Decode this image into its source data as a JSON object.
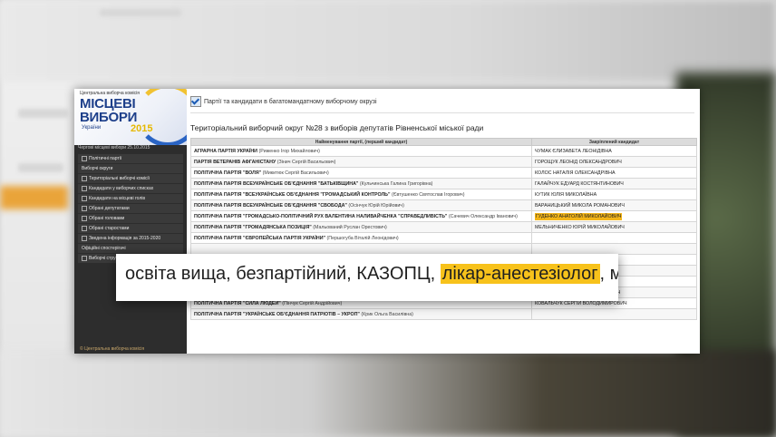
{
  "sidebar": {
    "cvk": "Центральна виборча комісія",
    "logo_title_line1": "МІСЦЕВІ",
    "logo_title_line2": "ВИБОРИ",
    "logo_country": "України",
    "logo_year": "2015",
    "election_date": "Чергові місцеві вибори 25.10.2015",
    "nav": [
      "Політичні партії",
      "Виборчі округи",
      "Територіальні виборчі комісії",
      "Кандидати у виборчих списках",
      "Кандидати на місцеві голів",
      "Обрані депутатами",
      "Обрані головами",
      "Обрані старостами",
      "Зведена інформація за 2015-2020",
      "Офіційні спостерігачі",
      "Виборчі структури"
    ],
    "footer": "© Центральна виборча комісія"
  },
  "content": {
    "checkbox_label": "Партії та кандидати в багатомандатному виборчому окрузі",
    "heading": "Територіальний виборчий округ №28 з виборів депутатів Рівненської міської ради",
    "table_headers": [
      "Найменування партії, (перший кандидат)",
      "Закріплений кандидат"
    ],
    "rows": [
      {
        "party": "АГРАРНА ПАРТІЯ УКРАЇНИ",
        "lead": "(Риженко Ігор Михайлович)",
        "candidate": "ЧУМАК ЄЛИЗАВЕТА ЛЕОНІДІВНА"
      },
      {
        "party": "ПАРТІЯ ВЕТЕРАНІВ АФГАНІСТАНУ",
        "lead": "(Зінич Сергій Васильович)",
        "candidate": "ГОРОЩУК ЛЕОНІД ОЛЕКСАНДРОВИЧ"
      },
      {
        "party": "ПОЛІТИЧНА ПАРТІЯ \"ВОЛЯ\"",
        "lead": "(Микитюк Сергій Васильович)",
        "candidate": "КОЛОС НАТАЛІЯ ОЛЕКСАНДРІВНА"
      },
      {
        "party": "ПОЛІТИЧНА ПАРТІЯ ВСЕУКРАЇНСЬКЕ ОБ'ЄДНАННЯ \"БАТЬКІВЩИНА\"",
        "lead": "(Кульчинська Галина Григорівна)",
        "candidate": "ГАЛАЙЧУК ЕДУАРД КОСТЯНТИНОВИЧ"
      },
      {
        "party": "ПОЛІТИЧНА ПАРТІЯ \"ВСЕУКРАЇНСЬКЕ ОБ'ЄДНАННЯ \"ГРОМАДСЬКИЙ КОНТРОЛЬ\"",
        "lead": "(Євтушенко Святослав Ігорович)",
        "candidate": "КУТИК ЮЛІЯ МИКОЛАЇВНА"
      },
      {
        "party": "ПОЛІТИЧНА ПАРТІЯ ВСЕУКРАЇНСЬКЕ ОБ'ЄДНАННЯ \"СВОБОДА\"",
        "lead": "(Осінчук Юрій Юрійович)",
        "candidate": "ВАРАНИЦЬКИЙ МИКОЛА РОМАНОВИЧ"
      },
      {
        "party": "ПОЛІТИЧНА ПАРТІЯ \"ГРОМАДСЬКО-ПОЛІТИЧНИЙ РУХ ВАЛЕНТИНА НАЛИВАЙЧЕНКА \"СПРАВЕДЛИВІСТЬ\"",
        "lead": "(Сачевич Олександр Іванович)",
        "candidate": "ГУДЕНКО АНАТОЛІЙ МИКОЛАЙОВИЧ",
        "highlight": true
      },
      {
        "party": "ПОЛІТИЧНА ПАРТІЯ \"ГРОМАДЯНСЬКА ПОЗИЦІЯ\"",
        "lead": "(Мальований Руслан Орестович)",
        "candidate": "МЕЛЬНИЧЕНКО ЮРІЙ МИКОЛАЙОВИЧ"
      },
      {
        "party": "ПОЛІТИЧНА ПАРТІЯ \"ЄВРОПЕЙСЬКА ПАРТІЯ УКРАЇНИ\"",
        "lead": "(Першогуба Віталій Леонідович)",
        "candidate": ""
      },
      {
        "party": "",
        "lead": "",
        "candidate": ""
      },
      {
        "party": "",
        "lead": "",
        "candidate": ""
      },
      {
        "party": "",
        "lead": "",
        "candidate": ""
      },
      {
        "party": "ПОЛІТИЧНА ПАРТІЯ \"ПАТРІОТ\"",
        "lead": "(Нечипорук Сергій Васильович)",
        "candidate": "ПЕРЕТЯТКО ГАЛИНА ЮРІЇВНА"
      },
      {
        "party": "ПОЛІТИЧНА ПАРТІЯ \"РАДИКАЛЬНА ПАРТІЯ ОЛЕГА ЛЯШКА\" (РАДИКАЛЬНА ПАРТІЯ ОЛЕГА ЛЯШКА)",
        "lead": "(Стасюк Роман Павлович)",
        "candidate": "КОМПАНЕЦЬ ЮРІЙ ВАЛЕНТИНОВИЧ"
      },
      {
        "party": "ПОЛІТИЧНА ПАРТІЯ \"СИЛА ЛЮДЕЙ\"",
        "lead": "(Пінчук Сергій Андрійович)",
        "candidate": "КОВАЛЬЧУК СЕРГІЙ ВОЛОДИМИРОВИЧ"
      },
      {
        "party": "ПОЛІТИЧНА ПАРТІЯ \"УКРАЇНСЬКЕ ОБ'ЄДНАННЯ ПАТРІОТІВ – УКРОП\"",
        "lead": "(Крик Ольга Василівна)",
        "candidate": ""
      }
    ]
  },
  "callout": {
    "text_before": "освіта вища, безпартійний, КАЗОПЦ, ",
    "highlighted": "лікар-анестезіолог",
    "text_after": ", м"
  }
}
